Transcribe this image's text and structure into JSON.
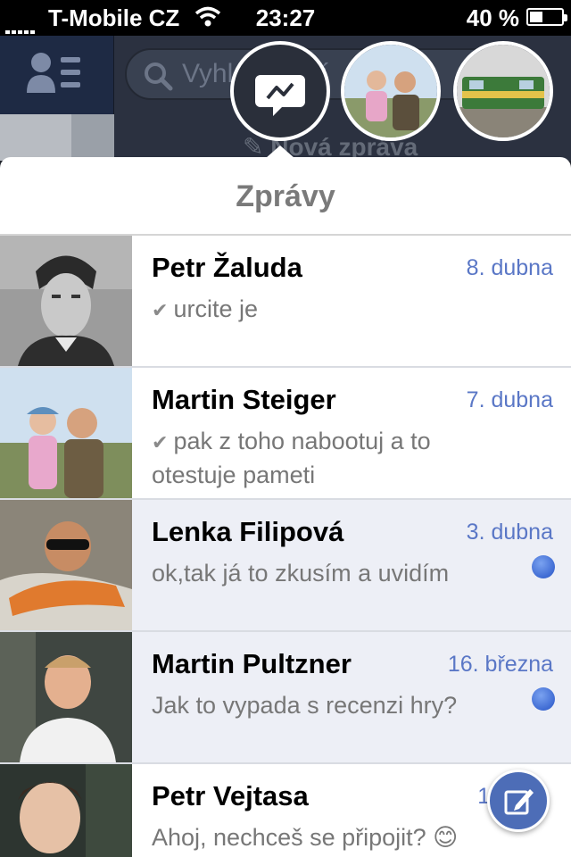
{
  "status_bar": {
    "carrier": "T-Mobile CZ",
    "time": "23:27",
    "battery": "40 %",
    "signal_icon": "signal-dots-icon",
    "wifi_icon": "wifi-icon"
  },
  "background": {
    "search_placeholder": "Vyhledávání",
    "compose_label": "Nová zpráva"
  },
  "sheet": {
    "title": "Zprávy"
  },
  "conversations": [
    {
      "name": "Petr Žaluda",
      "date": "8. dubna",
      "snippet": "urcite je",
      "sent_check": true,
      "unread": false
    },
    {
      "name": "Martin Steiger",
      "date": "7. dubna",
      "snippet": "pak z toho nabootuj a to otestuje pameti",
      "sent_check": true,
      "unread": false
    },
    {
      "name": "Lenka Filipová",
      "date": "3. dubna",
      "snippet": "ok,tak já to zkusím a uvidím",
      "sent_check": false,
      "unread": true
    },
    {
      "name": "Martin Pultzner",
      "date": "16. března",
      "snippet": "Jak to vypada s recenzi hry?",
      "sent_check": false,
      "unread": true
    },
    {
      "name": "Petr Vejtasa",
      "date": "14.",
      "snippet": "Ahoj, nechceš se připojit? 😊",
      "sent_check": false,
      "unread": false
    }
  ],
  "colors": {
    "accent": "#5a77c6",
    "unread_bg": "#edeff6",
    "header_bg": "#2b3140"
  }
}
